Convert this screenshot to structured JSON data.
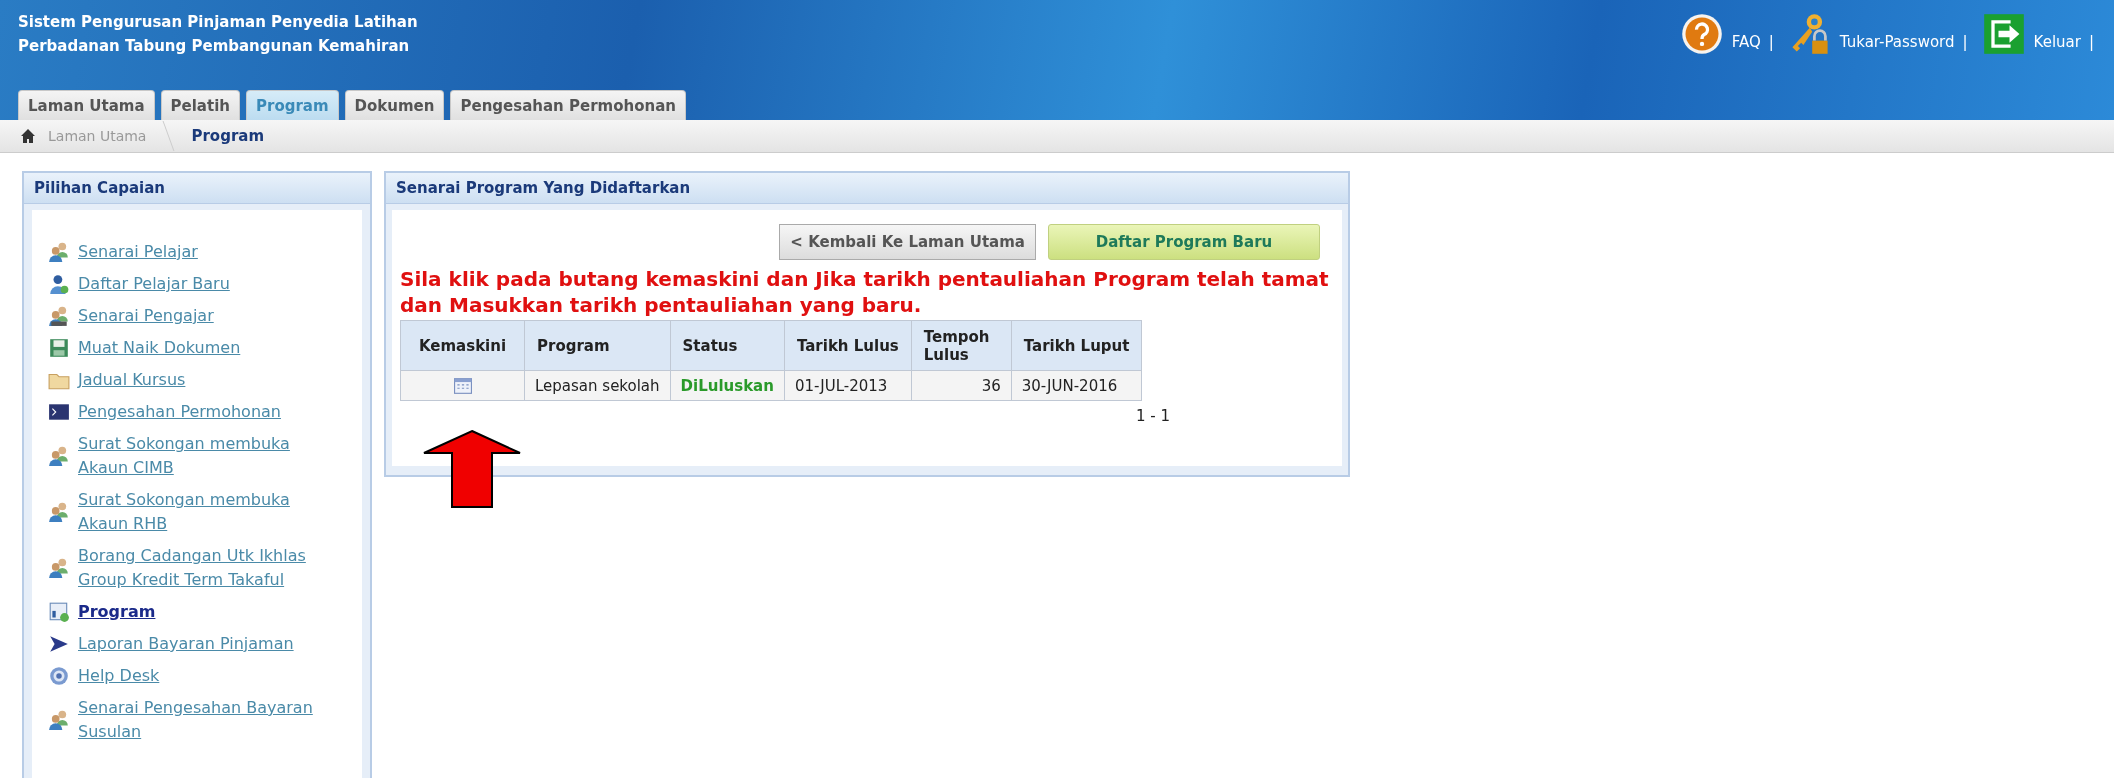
{
  "header": {
    "title_lines": [
      "Sistem Pengurusan Pinjaman Penyedia Latihan",
      "Perbadanan Tabung Pembangunan Kemahiran"
    ],
    "links": [
      {
        "label": "FAQ",
        "kind": "help"
      },
      {
        "label": "Tukar-Password",
        "kind": "key"
      },
      {
        "label": "Keluar",
        "kind": "exit"
      }
    ],
    "separator": "|"
  },
  "tabs": [
    {
      "label": "Laman Utama",
      "selected": false
    },
    {
      "label": "Pelatih",
      "selected": false
    },
    {
      "label": "Program",
      "selected": true
    },
    {
      "label": "Dokumen",
      "selected": false
    },
    {
      "label": "Pengesahan Permohonan",
      "selected": false
    }
  ],
  "breadcrumb": [
    {
      "label": "Laman Utama",
      "current": false
    },
    {
      "label": "Program",
      "current": true
    }
  ],
  "sidebar": {
    "title": "Pilihan Capaian",
    "items": [
      {
        "label": "Senarai Pelajar",
        "kind": "people",
        "selected": false
      },
      {
        "label": "Daftar Pelajar Baru",
        "kind": "person",
        "selected": false
      },
      {
        "label": "Senarai Pengajar",
        "kind": "group",
        "selected": false
      },
      {
        "label": "Muat Naik Dokumen",
        "kind": "disk",
        "selected": false
      },
      {
        "label": "Jadual Kursus",
        "kind": "folder",
        "selected": false
      },
      {
        "label": "Pengesahan Permohonan",
        "kind": "terminal",
        "selected": false
      },
      {
        "label": "Surat Sokongan membuka Akaun CIMB",
        "kind": "people",
        "selected": false
      },
      {
        "label": "Surat Sokongan membuka Akaun RHB",
        "kind": "people",
        "selected": false
      },
      {
        "label": "Borang Cadangan Utk Ikhlas Group Kredit Term Takaful",
        "kind": "people",
        "selected": false
      },
      {
        "label": "Program",
        "kind": "program",
        "selected": true
      },
      {
        "label": "Laporan Bayaran Pinjaman",
        "kind": "play",
        "selected": false
      },
      {
        "label": "Help Desk",
        "kind": "help",
        "selected": false
      },
      {
        "label": "Senarai Pengesahan Bayaran Susulan",
        "kind": "people",
        "selected": false
      }
    ]
  },
  "main": {
    "title": "Senarai Program Yang Didaftarkan",
    "buttons": [
      {
        "label": "< Kembali Ke Laman Utama",
        "kind": "back"
      },
      {
        "label": "Daftar Program Baru",
        "kind": "primary"
      }
    ],
    "notice": "Sila klik pada butang kemaskini dan Jika tarikh pentauliahan Program telah tamat dan Masukkan tarikh pentauliahan yang baru.",
    "table": {
      "columns": [
        {
          "label": "Kemaskini",
          "kind": "edit"
        },
        {
          "label": "Program",
          "kind": "text"
        },
        {
          "label": "Status",
          "kind": "status"
        },
        {
          "label": "Tarikh Lulus",
          "kind": "text"
        },
        {
          "label": "Tempoh Lulus",
          "kind": "number"
        },
        {
          "label": "Tarikh Luput",
          "kind": "text"
        }
      ],
      "rows": [
        [
          "",
          "Lepasan sekolah",
          "DiLuluskan",
          "01-JUL-2013",
          "36",
          "30-JUN-2016"
        ]
      ]
    },
    "pagination": "1 - 1"
  }
}
